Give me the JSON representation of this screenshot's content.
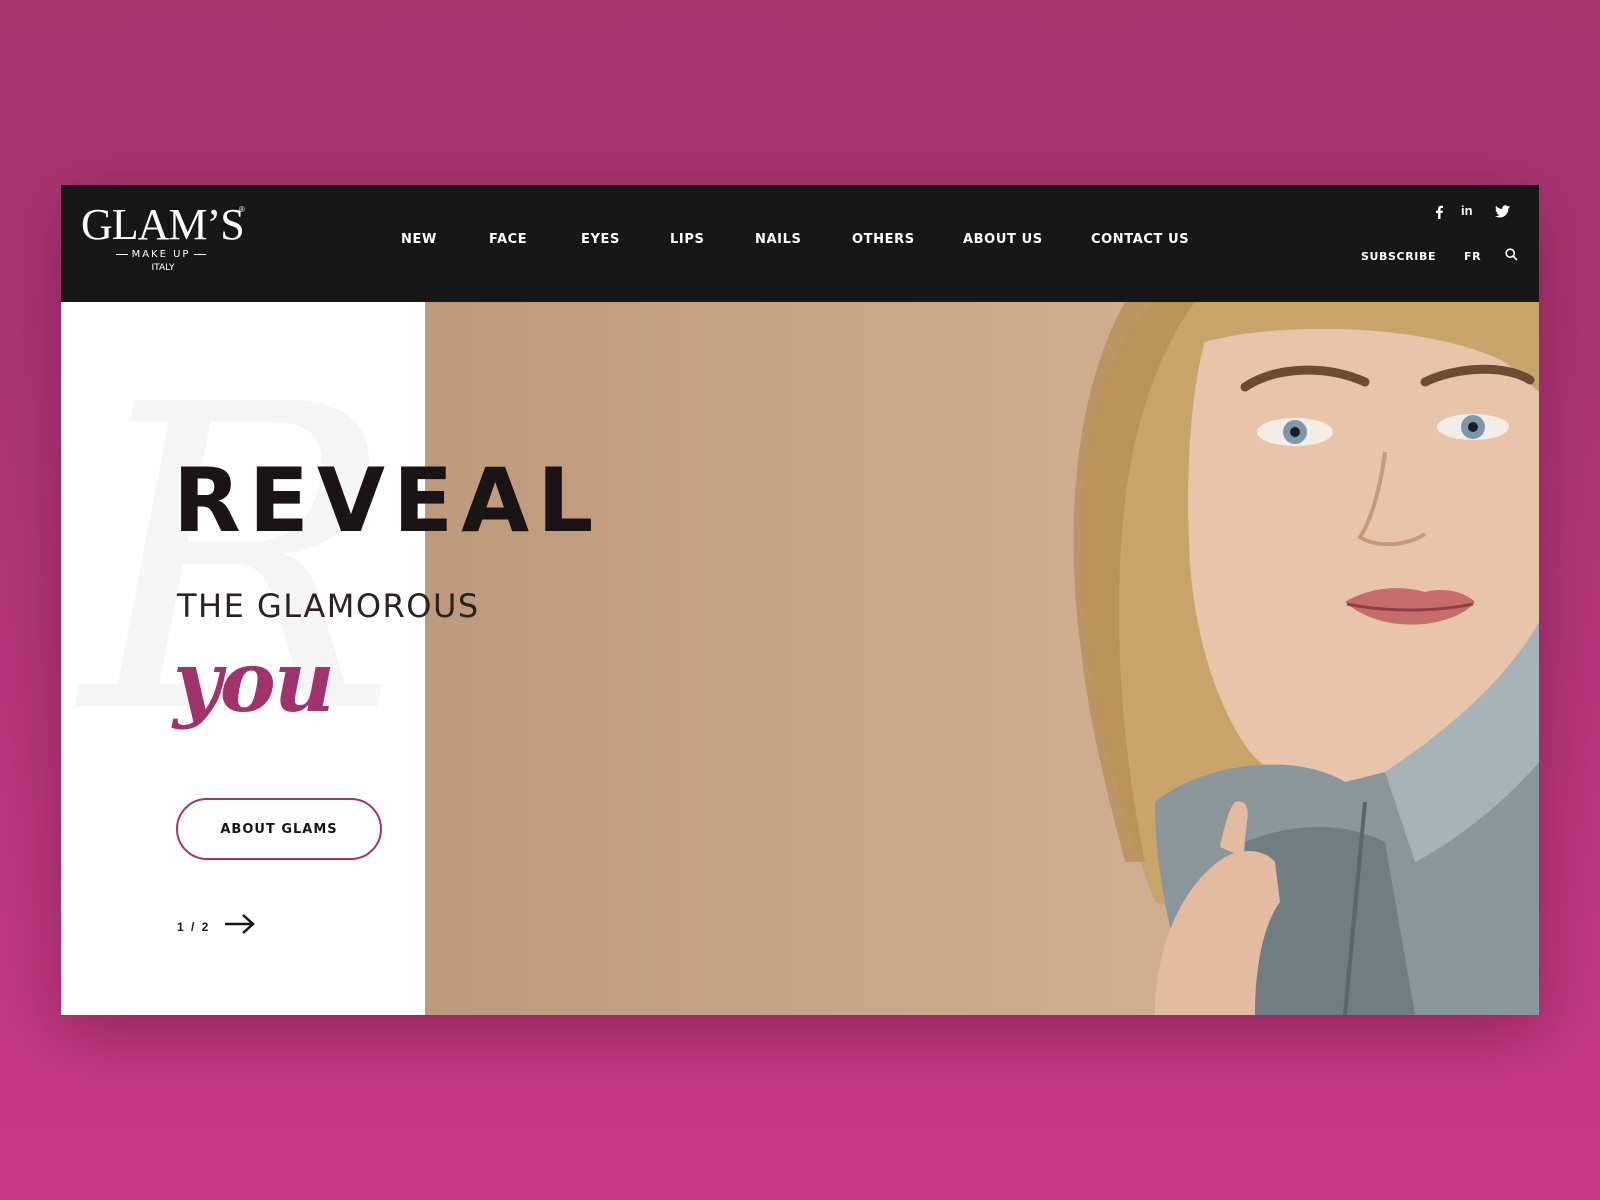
{
  "brand": {
    "name": "GLAM’S",
    "registered": "®",
    "subtitle": "MAKE UP",
    "country": "ITALY"
  },
  "nav": {
    "items": [
      {
        "label": "NEW"
      },
      {
        "label": "FACE"
      },
      {
        "label": "EYES"
      },
      {
        "label": "LIPS"
      },
      {
        "label": "NAILS"
      },
      {
        "label": "OTHERS"
      },
      {
        "label": "ABOUT US"
      },
      {
        "label": "CONTACT US"
      }
    ]
  },
  "header_right": {
    "social": [
      {
        "icon": "facebook-icon",
        "glyph": "f"
      },
      {
        "icon": "linkedin-icon",
        "glyph": "in"
      },
      {
        "icon": "twitter-icon",
        "glyph": "t"
      }
    ],
    "subscribe": "SUBSCRIBE",
    "language": "FR",
    "search_icon": "search-icon"
  },
  "hero": {
    "headline": "REVEAL",
    "subheadline": "THE GLAMOROUS",
    "script_word": "you",
    "background_letter": "R",
    "cta": "ABOUT GLAMS",
    "pager": "1 / 2",
    "next_icon": "arrow-right-icon"
  },
  "colors": {
    "page_bg_top": "#a5346f",
    "page_bg_bottom": "#c83a85",
    "header_bg": "#171717",
    "accent": "#a0336b",
    "photo_bg": "#c6a486"
  }
}
